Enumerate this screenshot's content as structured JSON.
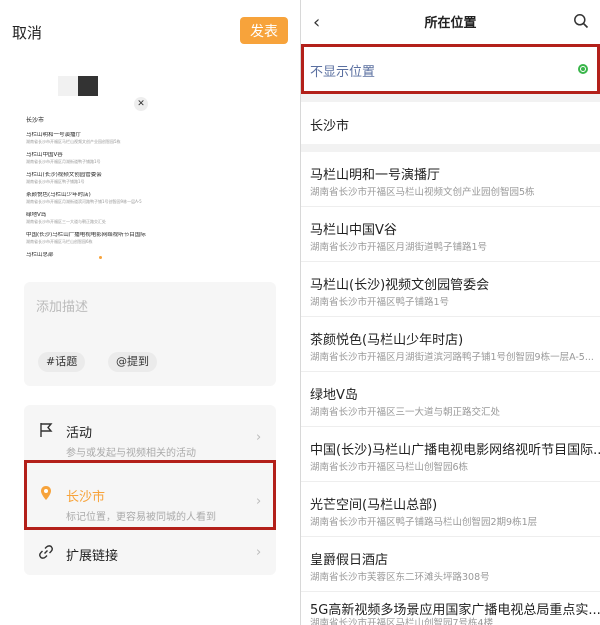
{
  "left": {
    "cancel": "取消",
    "publish": "发表",
    "thumbnail": {
      "city": "长沙市",
      "rows": [
        {
          "name": "马栏山明和一号演播厅",
          "addr": "湖南省长沙市开福区马栏山视频文创产业园创智园5栋"
        },
        {
          "name": "马栏山中国V谷",
          "addr": "湖南省长沙市开福区月湖街道鸭子铺路1号"
        },
        {
          "name": "马栏山(长沙)视频文创园管委会",
          "addr": "湖南省长沙市开福区鸭子铺路1号"
        },
        {
          "name": "茶颜悦色(马栏山少年时店)",
          "addr": "湖南省长沙市开福区月湖街道滨河路鸭子铺1号创智园9栋一层A-5"
        },
        {
          "name": "绿地V岛",
          "addr": "湖南省长沙市开福区三一大道与朝正路交汇处"
        },
        {
          "name": "中国(长沙)马栏山广播电视电影网络视听节目国际",
          "addr": "湖南省长沙市开福区马栏山创智园6栋"
        },
        {
          "name": "马栏山总部",
          "addr": ""
        }
      ]
    },
    "description_placeholder": "添加描述",
    "tags": [
      "#话题",
      "@提到"
    ],
    "activity": {
      "title": "活动",
      "subtitle": "参与或发起与视频相关的活动"
    },
    "location": {
      "title": "长沙市",
      "subtitle": "标记位置，更容易被同城的人看到"
    },
    "extension": {
      "title": "扩展链接"
    },
    "accent_color": "#f7a33b",
    "highlight_color": "#b3201a"
  },
  "right": {
    "title": "所在位置",
    "hide_location": "不显示位置",
    "city": "长沙市",
    "places": [
      {
        "name": "马栏山明和一号演播厅",
        "addr": "湖南省长沙市开福区马栏山视频文创产业园创智园5栋"
      },
      {
        "name": "马栏山中国V谷",
        "addr": "湖南省长沙市开福区月湖街道鸭子铺路1号"
      },
      {
        "name": "马栏山(长沙)视频文创园管委会",
        "addr": "湖南省长沙市开福区鸭子铺路1号"
      },
      {
        "name": "茶颜悦色(马栏山少年时店)",
        "addr": "湖南省长沙市开福区月湖街道滨河路鸭子铺1号创智园9栋一层A-5..."
      },
      {
        "name": "绿地V岛",
        "addr": "湖南省长沙市开福区三一大道与朝正路交汇处"
      },
      {
        "name": "中国(长沙)马栏山广播电视电影网络视听节目国际...",
        "addr": "湖南省长沙市开福区马栏山创智园6栋"
      },
      {
        "name": "光芒空间(马栏山总部)",
        "addr": "湖南省长沙市开福区鸭子铺路马栏山创智园2期9栋1层"
      },
      {
        "name": "皇爵假日酒店",
        "addr": "湖南省长沙市芙蓉区东二环滩头坪路308号"
      },
      {
        "name": "5G高新视频多场景应用国家广播电视总局重点实...",
        "addr": "湖南省长沙市开福区马栏山创智园7号栋4楼"
      }
    ],
    "selected_color": "#39b54a"
  }
}
